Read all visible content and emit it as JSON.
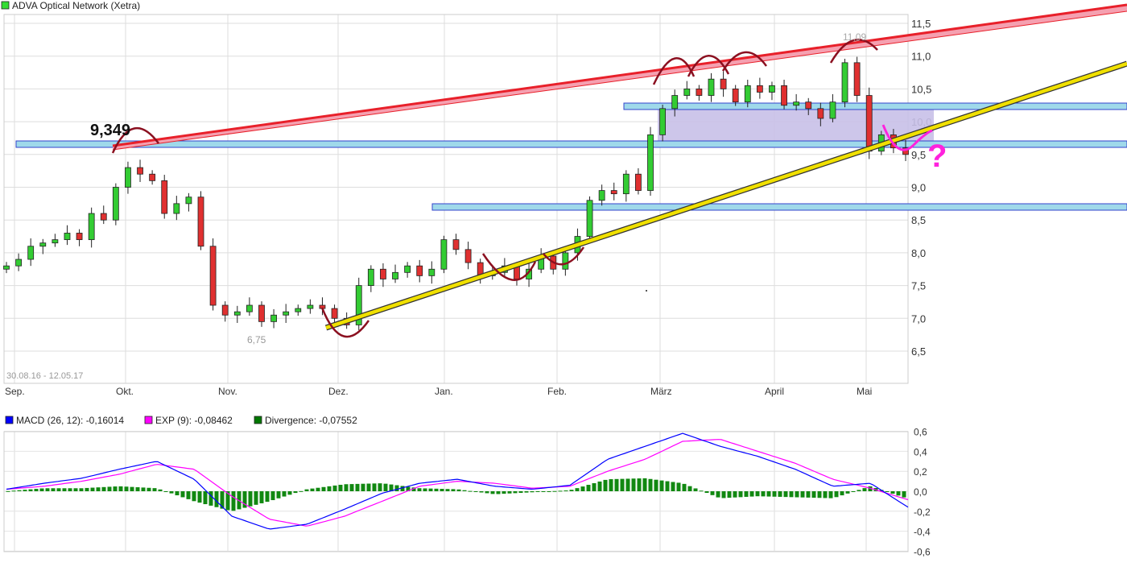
{
  "chart_data": [
    {
      "type": "candlestick",
      "title": "ADVA Optical Network (Xetra)",
      "legend_color": "#33dd33",
      "date_range": "30.08.16 - 12.05.17",
      "x_ticks": [
        "Sep.",
        "Okt.",
        "Nov.",
        "Dez.",
        "Jan.",
        "Feb.",
        "März",
        "April",
        "Mai"
      ],
      "y_ticks": [
        "11,5",
        "11,0",
        "10,5",
        "10,0",
        "9,5",
        "9,0",
        "8,5",
        "8,0",
        "7,5",
        "7,0",
        "6,5"
      ],
      "ylim": [
        6.5,
        11.5
      ],
      "grid": true,
      "up_color": "#33cc33",
      "down_color": "#e03030",
      "close": [
        7.8,
        7.9,
        8.1,
        8.15,
        8.2,
        8.3,
        8.2,
        8.6,
        8.5,
        9.0,
        9.3,
        9.2,
        9.1,
        8.6,
        8.75,
        8.85,
        8.1,
        7.2,
        7.05,
        7.1,
        7.2,
        6.95,
        7.05,
        7.1,
        7.15,
        7.2,
        7.15,
        7.0,
        6.9,
        7.5,
        7.75,
        7.6,
        7.7,
        7.8,
        7.65,
        7.75,
        8.2,
        8.05,
        7.85,
        7.65,
        7.7,
        7.8,
        7.6,
        7.75,
        7.95,
        7.75,
        8.0,
        8.25,
        8.8,
        8.95,
        8.9,
        9.2,
        8.95,
        9.8,
        10.2,
        10.4,
        10.5,
        10.4,
        10.65,
        10.5,
        10.3,
        10.55,
        10.45,
        10.55,
        10.25,
        10.3,
        10.2,
        10.05,
        10.3,
        10.9,
        10.4,
        9.55,
        9.8,
        9.6,
        9.5
      ],
      "annotations": {
        "high_label": "9,349",
        "low_label": "6,75",
        "peak_label": "11,09",
        "question_mark": "?"
      },
      "support_levels": [
        9.35,
        10.0,
        8.35
      ],
      "colors": {
        "resistance": "#e8202a",
        "trend": "#f0e000",
        "band": "#9fd9ea",
        "zone": "#c8c0e8",
        "arcs": "#8b1020",
        "projection": "#ff22dd"
      }
    },
    {
      "type": "line",
      "legend": [
        {
          "name": "MACD (26, 12): -0,16014",
          "color": "#0000ff"
        },
        {
          "name": "EXP (9): -0,08462",
          "color": "#ff00ff"
        },
        {
          "name": "Divergence: -0,07552",
          "color": "#007700"
        }
      ],
      "y_ticks": [
        "0,6",
        "0,4",
        "0,2",
        "0,0",
        "-0,2",
        "-0,4",
        "-0,6"
      ],
      "ylim": [
        -0.6,
        0.6
      ],
      "macd": [
        0.02,
        0.08,
        0.13,
        0.22,
        0.3,
        0.12,
        -0.25,
        -0.38,
        -0.33,
        -0.18,
        -0.02,
        0.08,
        0.12,
        0.05,
        0.02,
        0.06,
        0.32,
        0.45,
        0.58,
        0.45,
        0.35,
        0.22,
        0.05,
        0.08,
        -0.16
      ],
      "exp": [
        0.02,
        0.05,
        0.1,
        0.17,
        0.27,
        0.22,
        -0.05,
        -0.28,
        -0.35,
        -0.25,
        -0.1,
        0.05,
        0.1,
        0.08,
        0.03,
        0.05,
        0.2,
        0.32,
        0.5,
        0.52,
        0.4,
        0.28,
        0.12,
        0.03,
        -0.085
      ]
    }
  ]
}
